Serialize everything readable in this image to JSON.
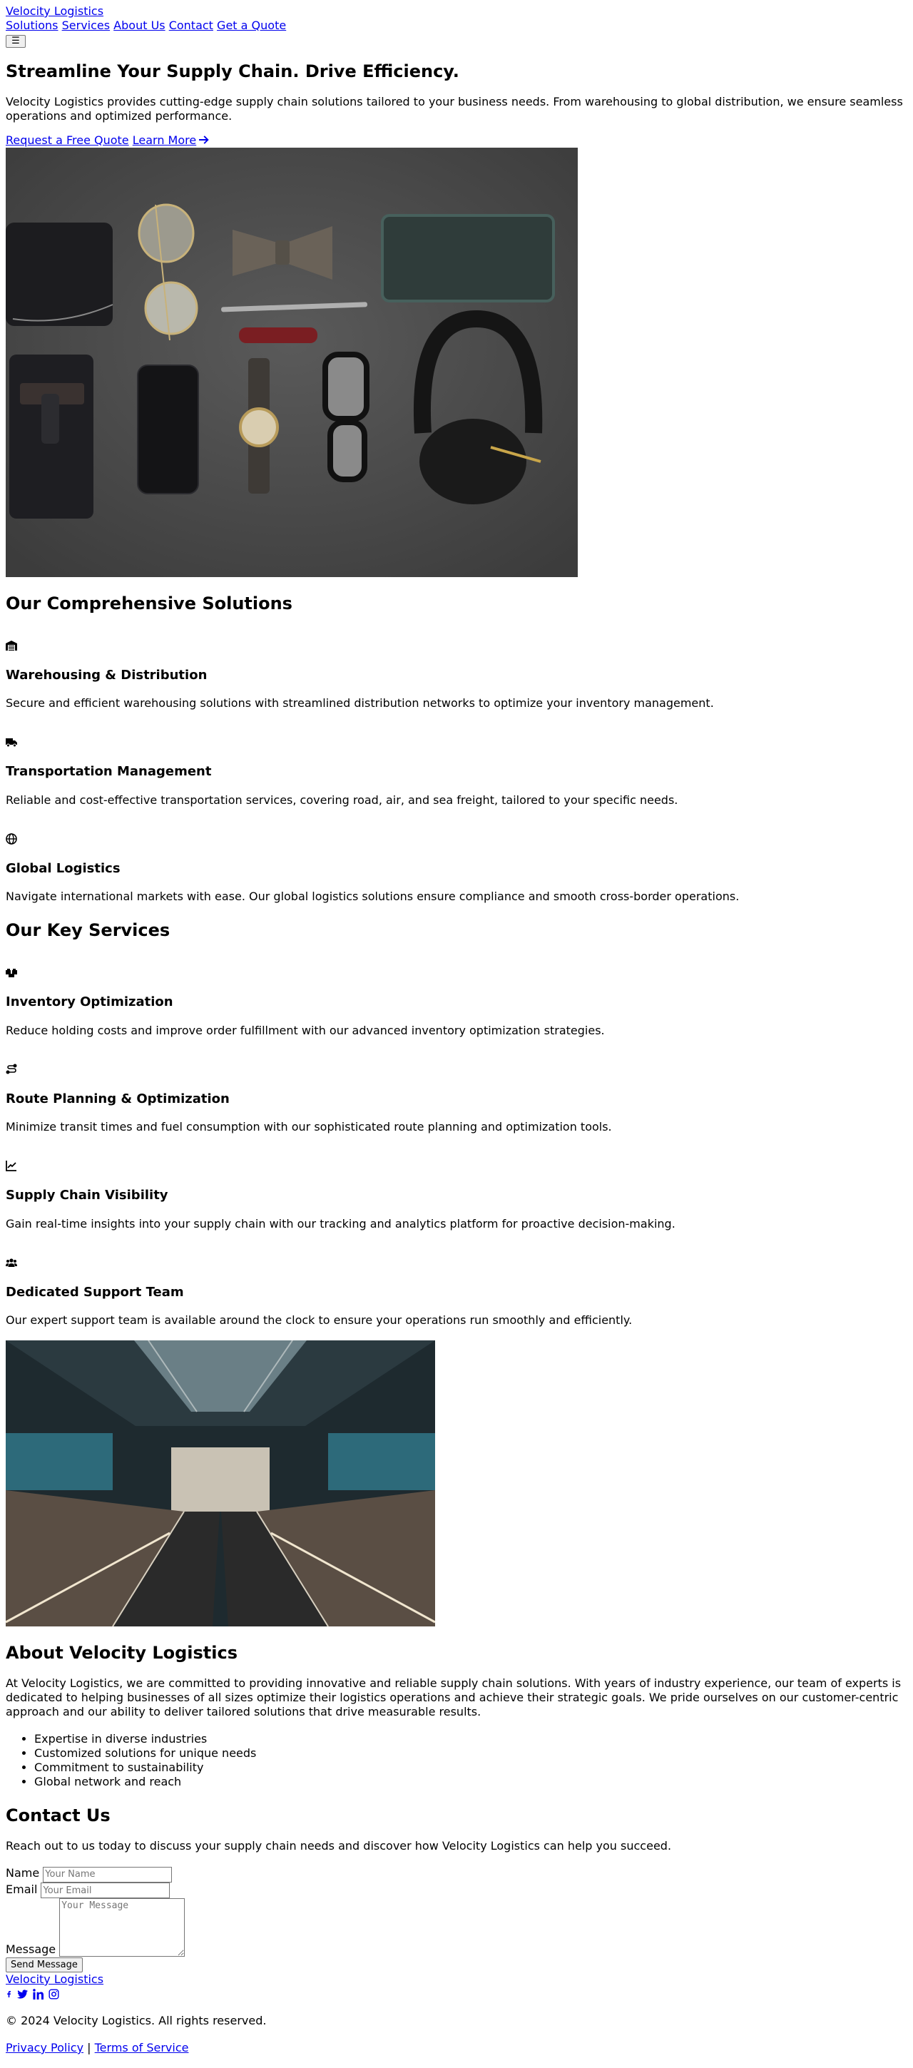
{
  "header": {
    "brand": "Velocity Logistics",
    "nav": [
      "Solutions",
      "Services",
      "About Us",
      "Contact",
      "Get a Quote"
    ],
    "menu_button": "☰"
  },
  "hero": {
    "title": "Streamline Your Supply Chain. Drive Efficiency.",
    "description": "Velocity Logistics provides cutting-edge supply chain solutions tailored to your business needs. From warehousing to global distribution, we ensure seamless operations and optimized performance.",
    "cta_primary": "Request a Free Quote",
    "cta_secondary": "Learn More",
    "image_subject": "flat-lay of wallet, aviator sunglasses, bow tie, notebook, pen, pocket knife, smartphone, wristwatch, eyeglasses, headphones"
  },
  "solutions": {
    "title": "Our Comprehensive Solutions",
    "items": [
      {
        "icon": "warehouse-icon",
        "title": "Warehousing & Distribution",
        "description": "Secure and efficient warehousing solutions with streamlined distribution networks to optimize your inventory management."
      },
      {
        "icon": "truck-icon",
        "title": "Transportation Management",
        "description": "Reliable and cost-effective transportation services, covering road, air, and sea freight, tailored to your specific needs."
      },
      {
        "icon": "globe-icon",
        "title": "Global Logistics",
        "description": "Navigate international markets with ease. Our global logistics solutions ensure compliance and smooth cross-border operations."
      }
    ]
  },
  "services": {
    "title": "Our Key Services",
    "items": [
      {
        "icon": "boxes-icon",
        "title": "Inventory Optimization",
        "description": "Reduce holding costs and improve order fulfillment with our advanced inventory optimization strategies."
      },
      {
        "icon": "route-icon",
        "title": "Route Planning & Optimization",
        "description": "Minimize transit times and fuel consumption with our sophisticated route planning and optimization tools."
      },
      {
        "icon": "chart-line-icon",
        "title": "Supply Chain Visibility",
        "description": "Gain real-time insights into your supply chain with our tracking and analytics platform for proactive decision-making."
      },
      {
        "icon": "users-icon",
        "title": "Dedicated Support Team",
        "description": "Our expert support team is available around the clock to ensure your operations run smoothly and efficiently."
      }
    ],
    "image_subject": "symmetrical escalators in a modern terminal building"
  },
  "about": {
    "title": "About Velocity Logistics",
    "description": "At Velocity Logistics, we are committed to providing innovative and reliable supply chain solutions. With years of industry experience, our team of experts is dedicated to helping businesses of all sizes optimize their logistics operations and achieve their strategic goals. We pride ourselves on our customer-centric approach and our ability to deliver tailored solutions that drive measurable results.",
    "points": [
      "Expertise in diverse industries",
      "Customized solutions for unique needs",
      "Commitment to sustainability",
      "Global network and reach"
    ]
  },
  "contact": {
    "title": "Contact Us",
    "description": "Reach out to us today to discuss your supply chain needs and discover how Velocity Logistics can help you succeed.",
    "name_label": "Name",
    "name_placeholder": "Your Name",
    "email_label": "Email",
    "email_placeholder": "Your Email",
    "message_label": "Message",
    "message_placeholder": "Your Message",
    "submit": "Send Message"
  },
  "footer": {
    "brand": "Velocity Logistics",
    "social": [
      "facebook-icon",
      "twitter-icon",
      "linkedin-icon",
      "instagram-icon"
    ],
    "copyright": "© 2024 Velocity Logistics. All rights reserved.",
    "privacy": "Privacy Policy",
    "separator": "|",
    "terms": "Terms of Service"
  },
  "colors": {
    "link": "#0000ee",
    "text": "#000000",
    "background": "#ffffff"
  }
}
